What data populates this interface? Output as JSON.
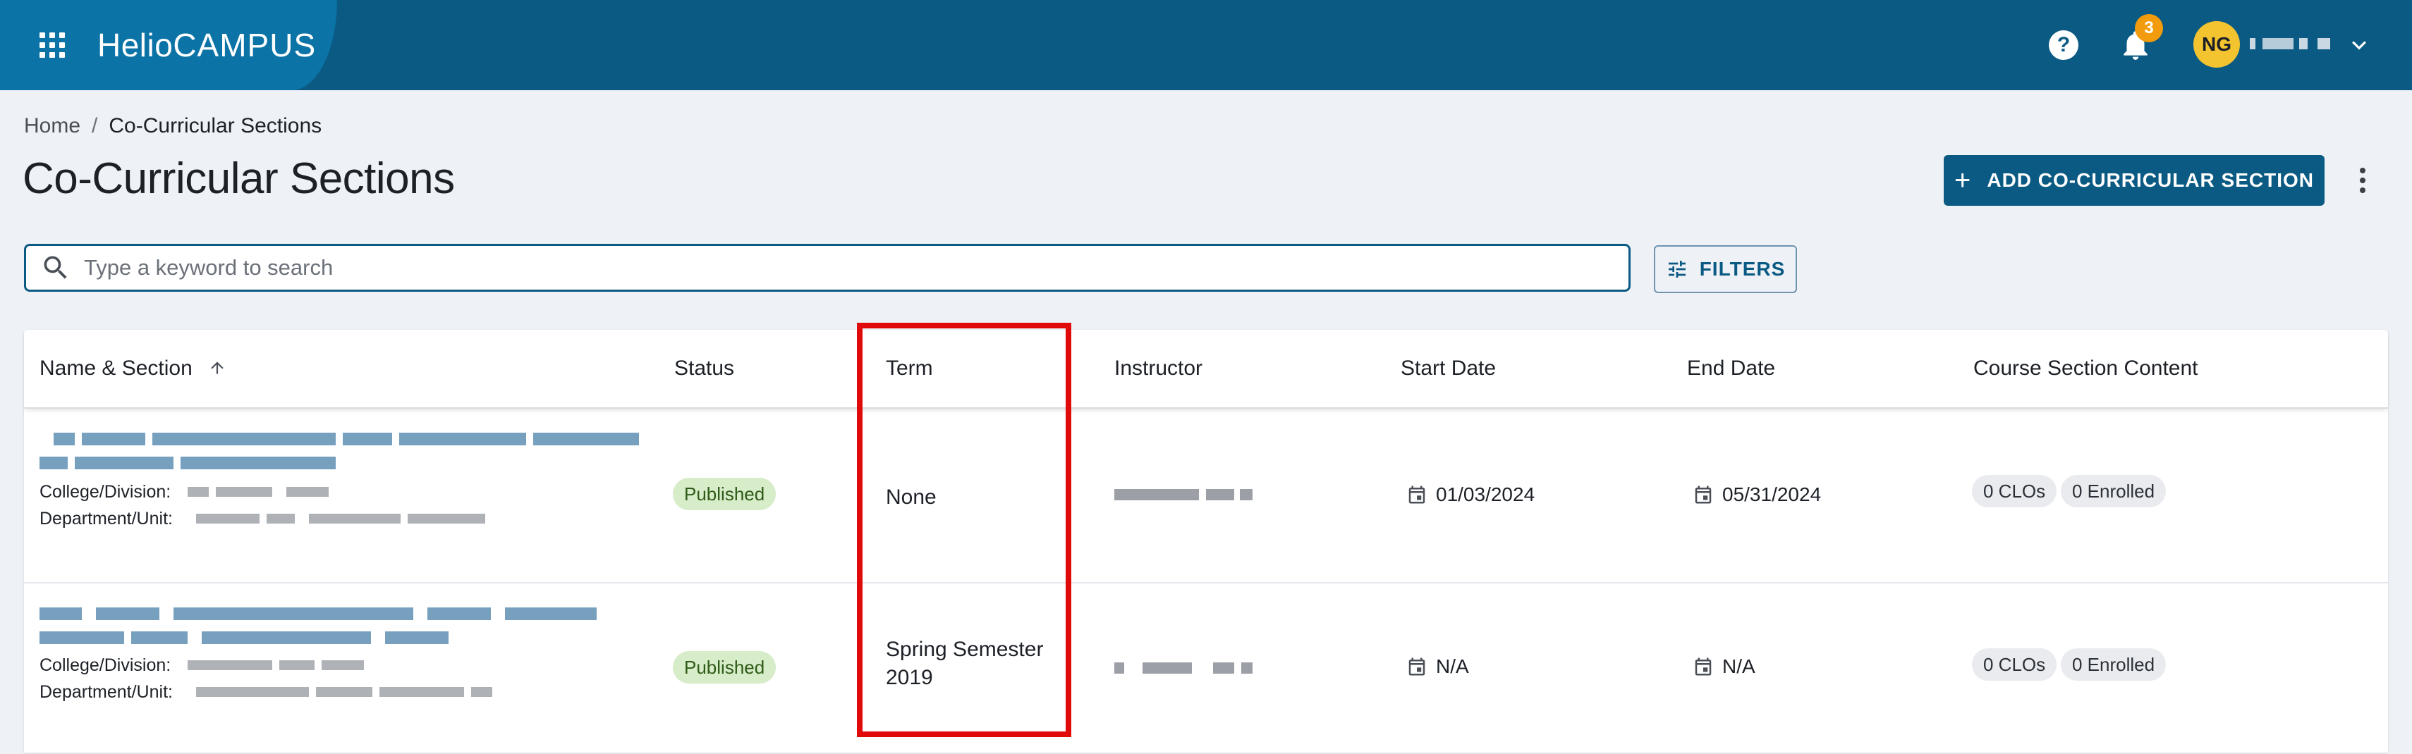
{
  "header": {
    "brand_part1": "Helio",
    "brand_part2": "CAMPUS",
    "notification_count": "3",
    "avatar_initials": "NG",
    "colors": {
      "bar": "#0a5a83",
      "brand_block": "#0b73a6",
      "badge": "#f29b0c",
      "avatar": "#f4c430"
    },
    "icons": [
      "apps-grid-icon",
      "help-icon",
      "bell-icon",
      "chevron-down-icon"
    ]
  },
  "breadcrumb": {
    "home": "Home",
    "separator": "/",
    "current": "Co-Curricular Sections"
  },
  "page_title": "Co-Curricular Sections",
  "actions": {
    "add_label": "ADD CO-CURRICULAR SECTION",
    "plus": "+"
  },
  "search": {
    "placeholder": "Type a keyword to search",
    "value": ""
  },
  "filters": {
    "label": "FILTERS"
  },
  "table": {
    "columns": {
      "name": "Name & Section",
      "status": "Status",
      "term": "Term",
      "instructor": "Instructor",
      "start": "Start Date",
      "end": "End Date",
      "content": "Course Section Content"
    },
    "sorted_by": "name",
    "rows": [
      {
        "college_label": "College/Division:",
        "department_label": "Department/Unit:",
        "status": "Published",
        "term": "None",
        "start_date": "01/03/2024",
        "end_date": "05/31/2024",
        "clos": "0 CLOs",
        "enrolled": "0 Enrolled"
      },
      {
        "college_label": "College/Division:",
        "department_label": "Department/Unit:",
        "status": "Published",
        "term_line1": "Spring Semester",
        "term_line2": "2019",
        "start_date": "N/A",
        "end_date": "N/A",
        "clos": "0 CLOs",
        "enrolled": "0 Enrolled"
      }
    ]
  },
  "highlight_color": "#e10a0a"
}
